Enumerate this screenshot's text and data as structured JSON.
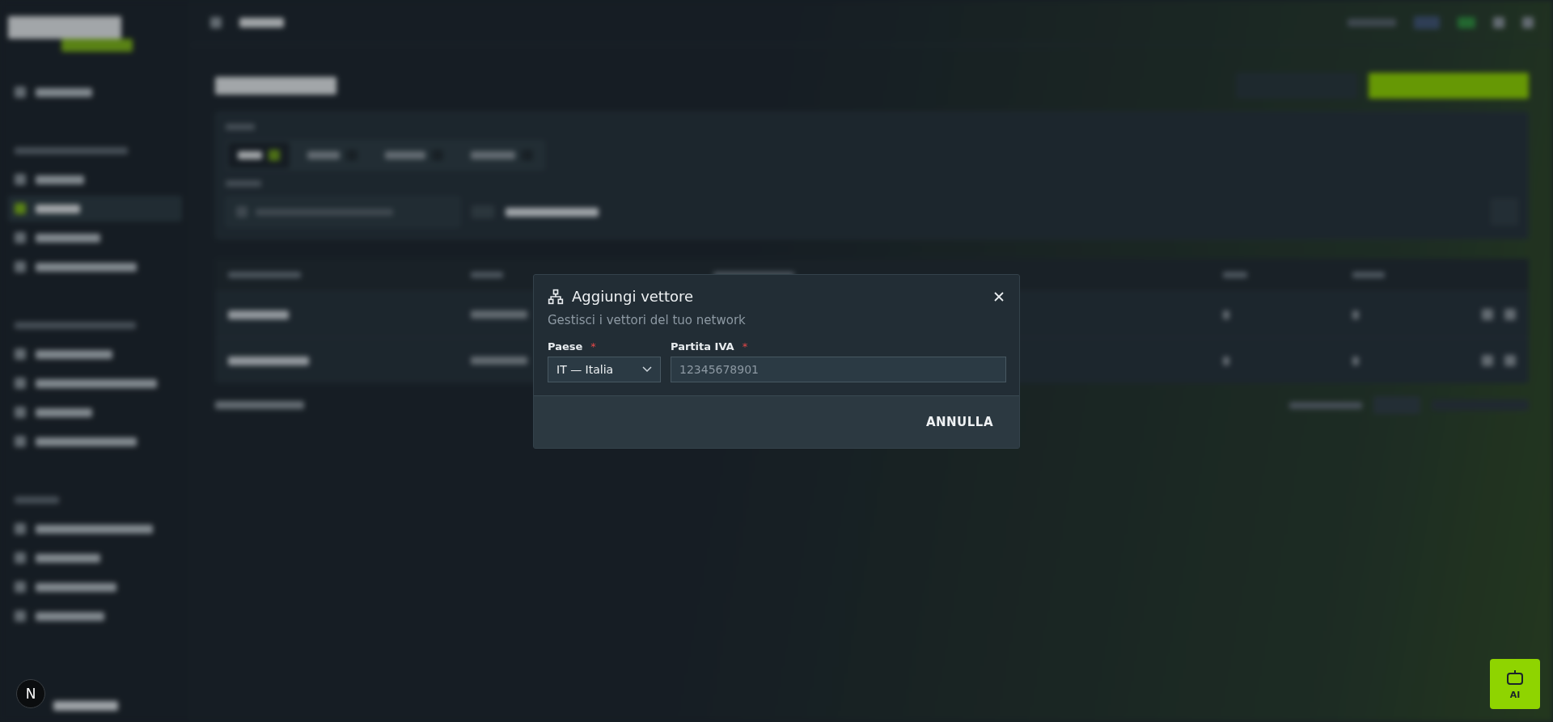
{
  "dialog": {
    "title": "Aggiungi vettore",
    "subtitle": "Gestisci i vettori del tuo network",
    "fields": [
      {
        "label": "Paese",
        "required_mark": "*",
        "kind": "select",
        "value": "IT — Italia"
      },
      {
        "label": "Partita IVA",
        "required_mark": "*",
        "kind": "text",
        "placeholder": "12345678901"
      }
    ],
    "buttons": [
      "ANNULLA"
    ]
  },
  "ai_button": {
    "label": "AI"
  },
  "avatar": {
    "letter": "N"
  }
}
